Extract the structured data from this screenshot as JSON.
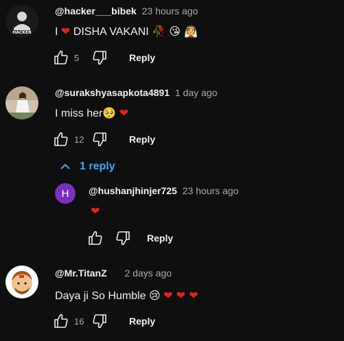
{
  "comments": [
    {
      "author": "@hacker___bibek",
      "time": "23 hours ago",
      "text_prefix": "I",
      "text_heart": "❤",
      "text_main": "DISHA VAKANI",
      "text_emojis": "🥀 😘 👰",
      "likes": "5",
      "reply_label": "Reply",
      "avatar_text": "HACKER"
    },
    {
      "author": "@surakshyasapkota4891",
      "time": "1 day ago",
      "text_main": "I miss her",
      "text_emojis": "🥺",
      "text_heart": "❤",
      "likes": "12",
      "reply_label": "Reply",
      "replies_toggle": "1 reply"
    },
    {
      "author": "@hushanjhinjer725",
      "time": "23 hours ago",
      "text_heart": "❤",
      "reply_label": "Reply",
      "avatar_letter": "H",
      "avatar_color": "#7b2fbe"
    },
    {
      "author": "@Mr.TitanZ",
      "time": "2 days ago",
      "text_main": "Daya ji So Humble",
      "text_emojis": "😢",
      "text_hearts": "❤ ❤ ❤",
      "likes": "16",
      "reply_label": "Reply"
    }
  ],
  "colors": {
    "background": "#0f0f0f",
    "link": "#3ea6ff",
    "heart": "#e62117",
    "secondary_text": "#aaaaaa"
  },
  "icons": [
    "thumbs-up-icon",
    "thumbs-down-icon",
    "chevron-up-icon"
  ]
}
